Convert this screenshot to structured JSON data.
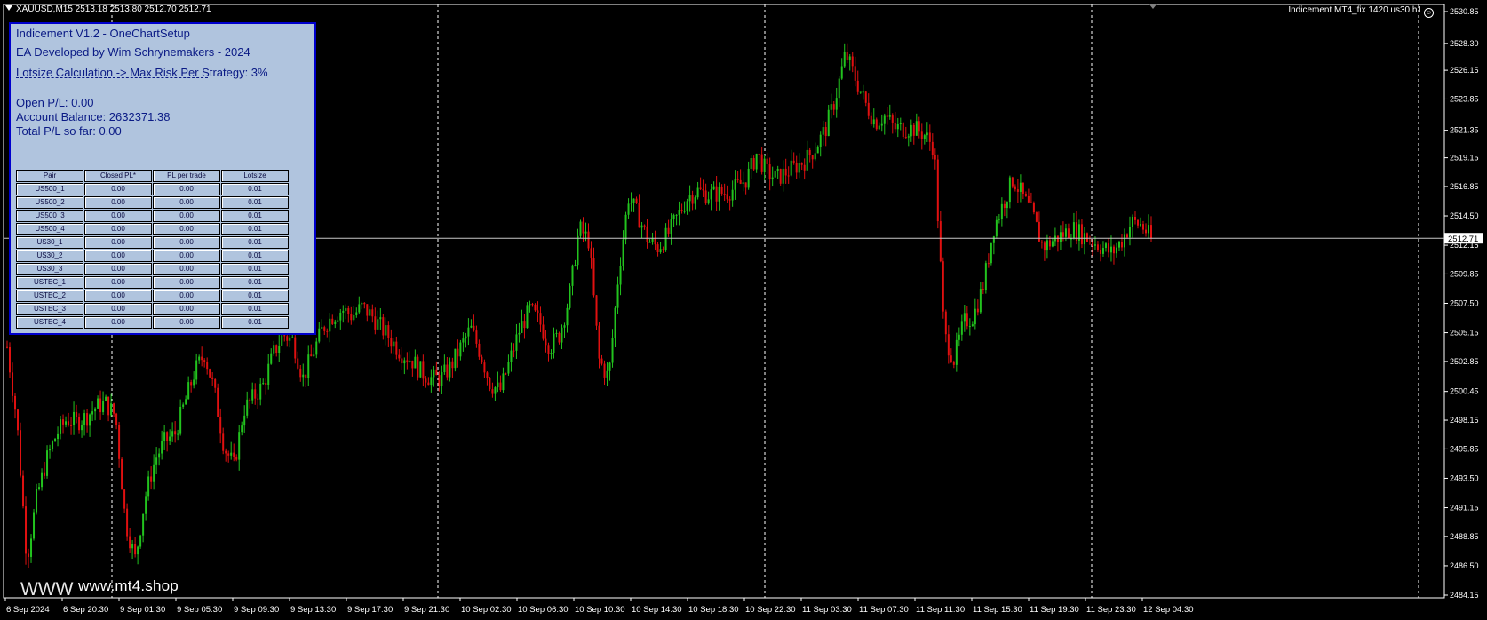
{
  "header": {
    "symbol_info": "XAUUSD,M15  2513.18 2513.80 2512.70 2512.71",
    "indicator_label": "Indicement MT4_fix 1420 us30 h1",
    "smile_icon": "☺"
  },
  "panel": {
    "title": "Indicement V1.2 - OneChartSetup",
    "developer": "EA Developed by Wim Schrynemakers - 2024",
    "lotsize_calc": "Lotsize Calculation -> Max Risk Per Strategy: 3%",
    "open_pl": "Open P/L: 0.00",
    "account_balance": "Account Balance: 2632371.38",
    "total_pl": "Total P/L so far: 0.00",
    "table": {
      "headers": [
        "Pair",
        "Closed PL*",
        "PL per trade",
        "Lotsize"
      ],
      "rows": [
        [
          "US500_1",
          "0.00",
          "0.00",
          "0.01"
        ],
        [
          "US500_2",
          "0.00",
          "0.00",
          "0.01"
        ],
        [
          "US500_3",
          "0.00",
          "0.00",
          "0.01"
        ],
        [
          "US500_4",
          "0.00",
          "0.00",
          "0.01"
        ],
        [
          "US30_1",
          "0.00",
          "0.00",
          "0.01"
        ],
        [
          "US30_2",
          "0.00",
          "0.00",
          "0.01"
        ],
        [
          "US30_3",
          "0.00",
          "0.00",
          "0.01"
        ],
        [
          "USTEC_1",
          "0.00",
          "0.00",
          "0.01"
        ],
        [
          "USTEC_2",
          "0.00",
          "0.00",
          "0.01"
        ],
        [
          "USTEC_3",
          "0.00",
          "0.00",
          "0.01"
        ],
        [
          "USTEC_4",
          "0.00",
          "0.00",
          "0.01"
        ]
      ]
    }
  },
  "watermark": "www.mt4.shop",
  "watermark_ghost": "WWW",
  "chart_data": {
    "type": "candlestick",
    "symbol": "XAUUSD",
    "timeframe": "M15",
    "ohlc_last": {
      "open": 2513.18,
      "high": 2513.8,
      "low": 2512.7,
      "close": 2512.71
    },
    "current_price_label": "2512.71",
    "y_ticks": [
      "2530.85",
      "2528.30",
      "2526.15",
      "2523.85",
      "2521.35",
      "2519.15",
      "2516.85",
      "2514.50",
      "2512.15",
      "2509.85",
      "2507.50",
      "2505.15",
      "2502.85",
      "2500.45",
      "2498.15",
      "2495.85",
      "2493.50",
      "2491.15",
      "2488.85",
      "2486.50",
      "2484.15"
    ],
    "ylim": [
      2484.15,
      2530.85
    ],
    "x_ticks": [
      "6 Sep 2024",
      "6 Sep 20:30",
      "9 Sep 01:30",
      "9 Sep 05:30",
      "9 Sep 09:30",
      "9 Sep 13:30",
      "9 Sep 17:30",
      "9 Sep 21:30",
      "10 Sep 02:30",
      "10 Sep 06:30",
      "10 Sep 10:30",
      "10 Sep 14:30",
      "10 Sep 18:30",
      "10 Sep 22:30",
      "11 Sep 03:30",
      "11 Sep 07:30",
      "11 Sep 11:30",
      "11 Sep 15:30",
      "11 Sep 19:30",
      "11 Sep 23:30",
      "12 Sep 04:30"
    ],
    "day_separators": [
      "9 Sep",
      "10 Sep",
      "11 Sep",
      "12 Sep"
    ],
    "price_path": [
      2504.0,
      2498.0,
      2487.0,
      2492.0,
      2495.0,
      2497.0,
      2498.2,
      2498.0,
      2498.4,
      2499.2,
      2499.5,
      2498.5,
      2490.0,
      2487.0,
      2492.0,
      2495.0,
      2496.5,
      2497.0,
      2499.5,
      2502.0,
      2503.5,
      2500.5,
      2496.0,
      2494.5,
      2499.0,
      2500.0,
      2501.0,
      2503.5,
      2505.0,
      2504.5,
      2501.5,
      2503.5,
      2505.5,
      2506.5,
      2507.0,
      2506.5,
      2507.2,
      2506.5,
      2505.5,
      2504.5,
      2503.5,
      2503.0,
      2502.0,
      2501.5,
      2501.5,
      2502.5,
      2504.0,
      2505.5,
      2503.5,
      2501.0,
      2500.5,
      2503.0,
      2505.5,
      2507.0,
      2506.0,
      2504.0,
      2505.0,
      2508.0,
      2513.5,
      2512.5,
      2503.0,
      2501.5,
      2510.0,
      2516.0,
      2514.5,
      2512.5,
      2512.0,
      2513.0,
      2514.5,
      2516.0,
      2516.5,
      2516.2,
      2516.3,
      2516.4,
      2516.8,
      2517.5,
      2519.5,
      2518.0,
      2517.5,
      2518.0,
      2518.5,
      2519.0,
      2520.0,
      2521.5,
      2524.0,
      2527.5,
      2525.5,
      2523.5,
      2522.0,
      2522.5,
      2521.5,
      2521.5,
      2521.5,
      2521.0,
      2520.0,
      2505.0,
      2503.0,
      2506.0,
      2506.5,
      2509.0,
      2513.5,
      2515.5,
      2517.5,
      2516.0,
      2514.5,
      2512.0,
      2512.5,
      2513.0,
      2513.5,
      2513.0,
      2512.5,
      2512.0,
      2511.5,
      2512.5,
      2514.0,
      2513.8,
      2512.7
    ]
  }
}
